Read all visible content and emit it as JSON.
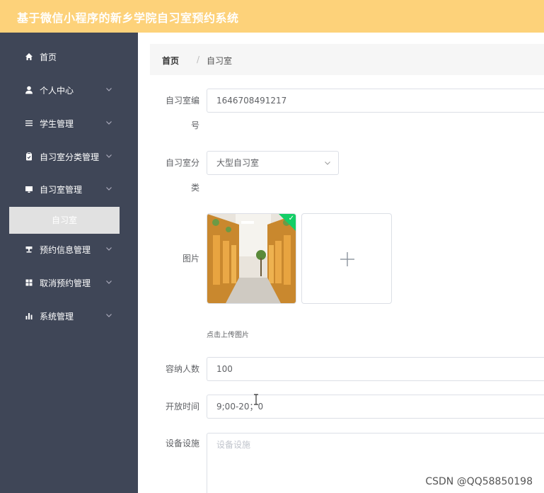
{
  "app": {
    "title": "基于微信小程序的新乡学院自习室预约系统"
  },
  "sidebar": {
    "items": [
      {
        "label": "首页",
        "icon": "home-icon",
        "has_arrow": false
      },
      {
        "label": "个人中心",
        "icon": "user-icon",
        "has_arrow": true
      },
      {
        "label": "学生管理",
        "icon": "list-icon",
        "has_arrow": true
      },
      {
        "label": "自习室分类管理",
        "icon": "clipboard-icon",
        "has_arrow": true
      },
      {
        "label": "自习室管理",
        "icon": "monitor-icon",
        "has_arrow": true
      },
      {
        "label": "预约信息管理",
        "icon": "stamp-icon",
        "has_arrow": true
      },
      {
        "label": "取消预约管理",
        "icon": "grid-icon",
        "has_arrow": true
      },
      {
        "label": "系统管理",
        "icon": "bar-chart-icon",
        "has_arrow": true
      }
    ],
    "active_submenu": "自习室"
  },
  "breadcrumb": {
    "home": "首页",
    "separator": "/",
    "current": "自习室"
  },
  "form": {
    "room_number": {
      "label_line1": "自习室编",
      "label_line2": "号",
      "value": "1646708491217"
    },
    "room_category": {
      "label_line1": "自习室分",
      "label_line2": "类",
      "value": "大型自习室"
    },
    "image": {
      "label": "图片",
      "upload_tip": "点击上传图片"
    },
    "capacity": {
      "label": "容纳人数",
      "value": "100"
    },
    "open_time": {
      "label": "开放时间",
      "value": "9;00-20；0"
    },
    "facilities": {
      "label": "设备设施",
      "placeholder": "设备设施",
      "value": ""
    }
  },
  "watermark": "CSDN @QQ58850198",
  "colors": {
    "topbar": "#fdd27a",
    "sidebar": "#3f4657",
    "submenu_active": "#e1e1e1",
    "success": "#13ce66"
  }
}
